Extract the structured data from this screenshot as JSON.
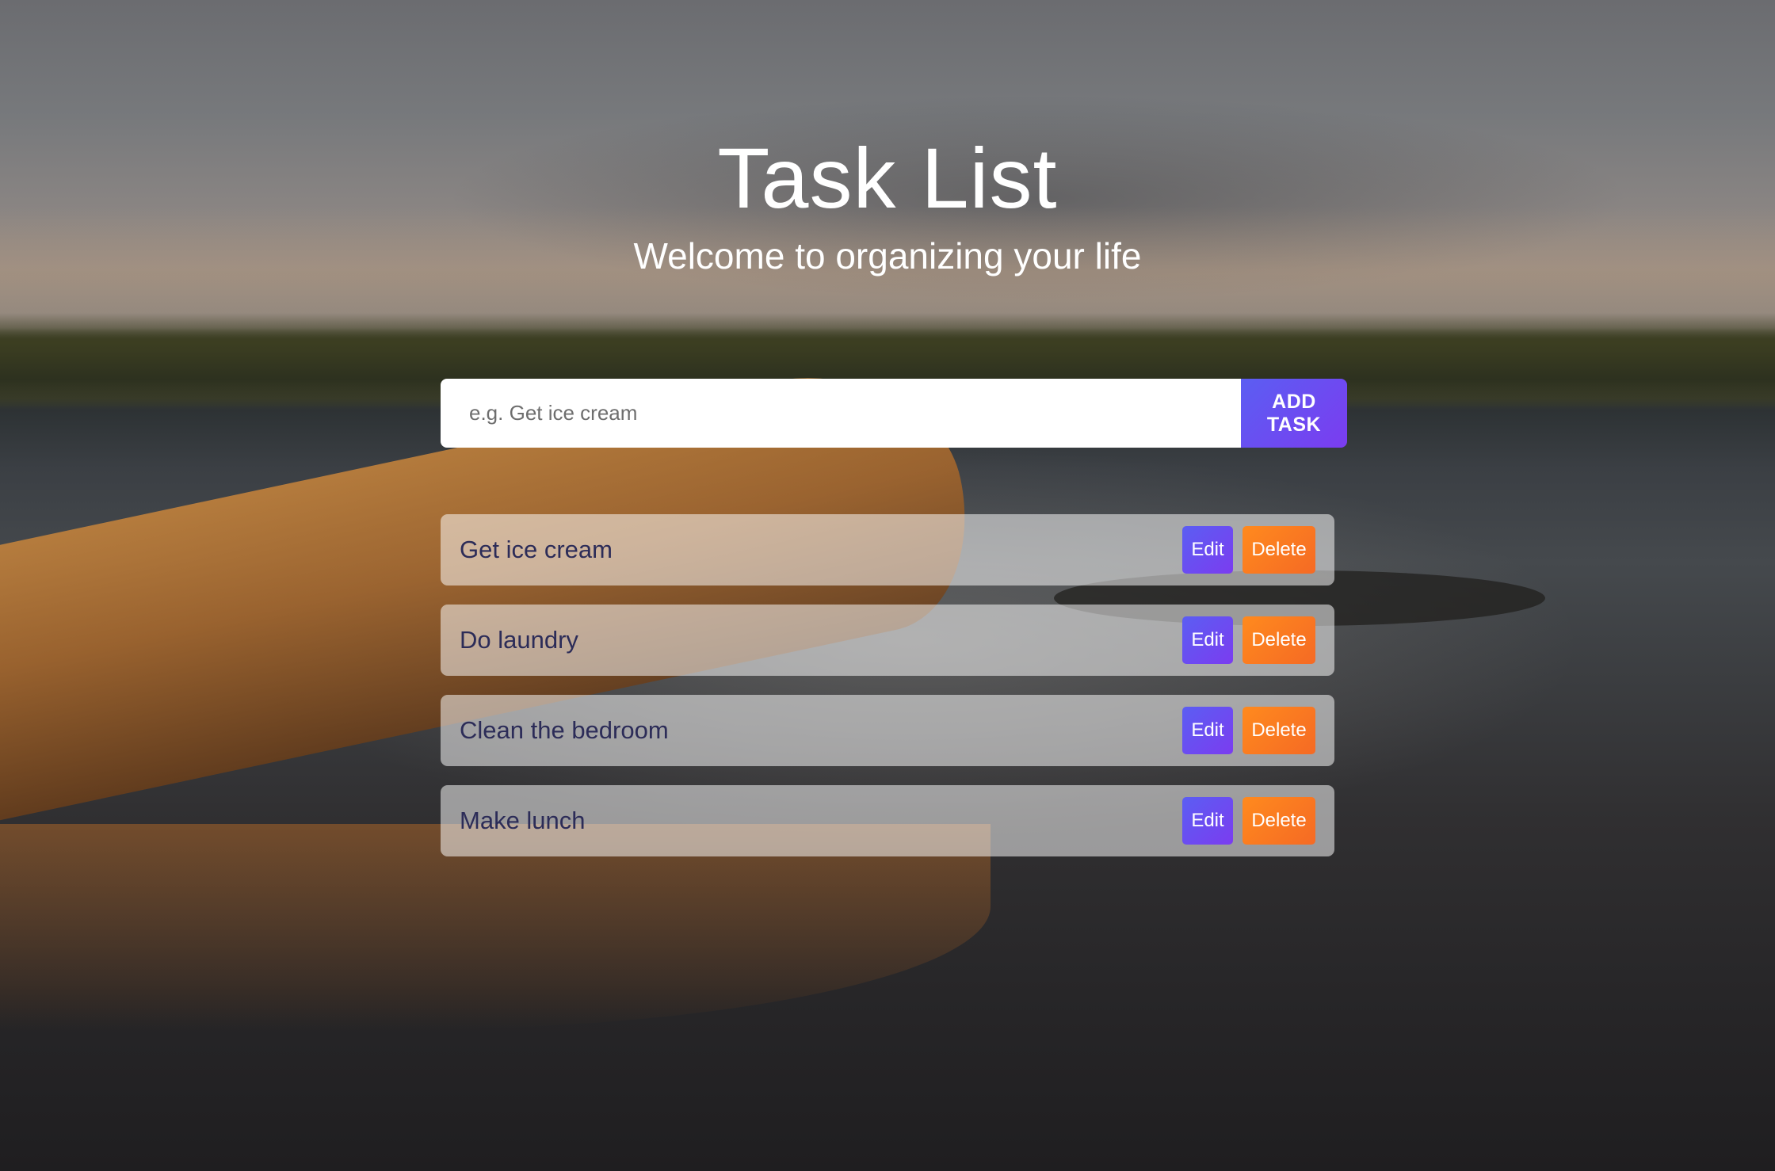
{
  "header": {
    "title": "Task List",
    "subtitle": "Welcome to organizing your life"
  },
  "form": {
    "input_value": "",
    "input_placeholder": "e.g. Get ice cream",
    "add_button_label": "ADD TASK"
  },
  "tasks": [
    {
      "name": "Get ice cream",
      "edit_label": "Edit",
      "delete_label": "Delete"
    },
    {
      "name": "Do laundry",
      "edit_label": "Edit",
      "delete_label": "Delete"
    },
    {
      "name": "Clean the bedroom",
      "edit_label": "Edit",
      "delete_label": "Delete"
    },
    {
      "name": "Make lunch",
      "edit_label": "Edit",
      "delete_label": "Delete"
    }
  ],
  "colors": {
    "primary_gradient_start": "#5b5ef2",
    "primary_gradient_end": "#7b3cf0",
    "delete_gradient_start": "#ff8a1e",
    "delete_gradient_end": "#f56a24",
    "task_text": "#2c2c58"
  }
}
